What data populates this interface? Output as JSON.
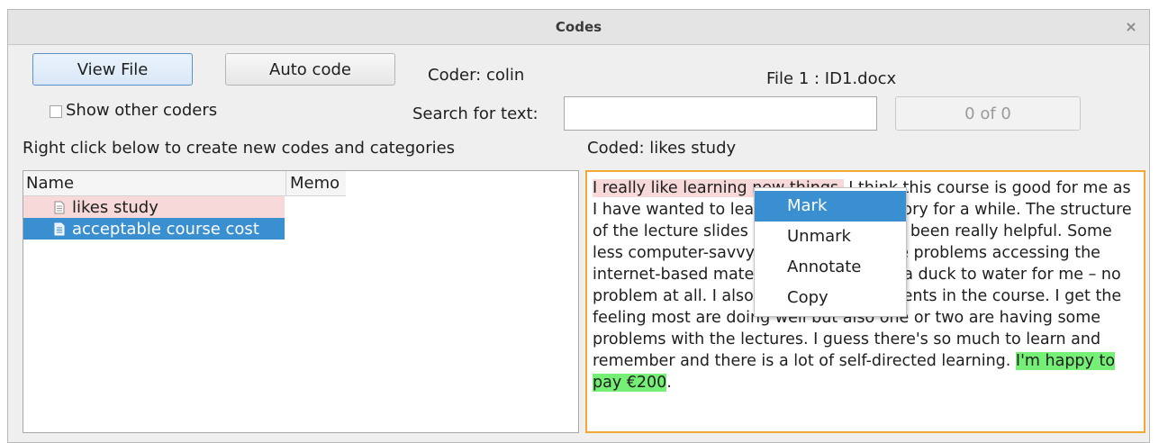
{
  "window": {
    "title": "Codes",
    "close_glyph": "×"
  },
  "toolbar": {
    "view_file_label": "View File",
    "auto_code_label": "Auto code",
    "coder_label": "Coder: colin",
    "file_label": "File 1 : ID1.docx"
  },
  "options": {
    "show_other_coders_label": "Show other coders",
    "show_other_coders_checked": false
  },
  "search": {
    "label": "Search for text:",
    "value": "",
    "counter": "0 of 0"
  },
  "instructions": "Right click below to create new codes and categories",
  "coded_label": "Coded: likes study",
  "tree": {
    "columns": [
      "Name",
      "Memo"
    ],
    "rows": [
      {
        "name": "likes study",
        "memo": "",
        "highlight": "#f7d9d9"
      },
      {
        "name": "acceptable course cost",
        "memo": "",
        "selected": true
      }
    ]
  },
  "document": {
    "seg_pink": "I really like learning new things.",
    "seg_middle": " I think this course is good for me as I have wanted to learn about world history for a while. The structure of the lecture slides and web links have been really helpful. Some less computer-savvy people would have problems accessing the internet-based material, but it was like a duck to water for me – no problem at all. I also like the other students in the course. I get the feeling most are doing well but also one or two are having some problems with the lectures. I guess there's so much to learn and remember and there is a lot of self-directed learning. ",
    "seg_green": "I'm happy to pay €200",
    "seg_end": "."
  },
  "context_menu": {
    "items": [
      "Mark",
      "Unmark",
      "Annotate",
      "Copy"
    ],
    "active_index": 0
  },
  "colors": {
    "code_pink": "#f7d9d9",
    "code_green": "#76ef76",
    "selection_blue": "#3a8fd0",
    "focus_orange": "#f3a735"
  }
}
